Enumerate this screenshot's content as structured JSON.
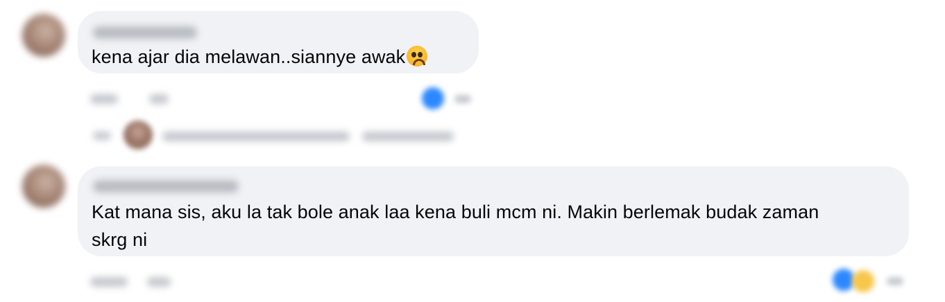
{
  "comments": [
    {
      "author": "",
      "text": "kena ajar dia melawan..siannye awak",
      "emoji": "pleading-face-icon",
      "actions": {
        "like": "",
        "reply": ""
      },
      "reactions": [
        "like-reaction-icon"
      ],
      "replies": {
        "summary": ""
      }
    },
    {
      "author": "",
      "text": "Kat mana sis, aku la tak bole anak laa kena buli mcm ni. Makin berlemak budak zaman skrg ni",
      "actions": {
        "like": "",
        "reply": ""
      },
      "reactions": [
        "like-reaction-icon",
        "haha-reaction-icon"
      ]
    }
  ],
  "colors": {
    "bubble": "#f0f2f5",
    "text": "#050505",
    "like": "#2d88ff",
    "haha": "#f7c64a"
  }
}
